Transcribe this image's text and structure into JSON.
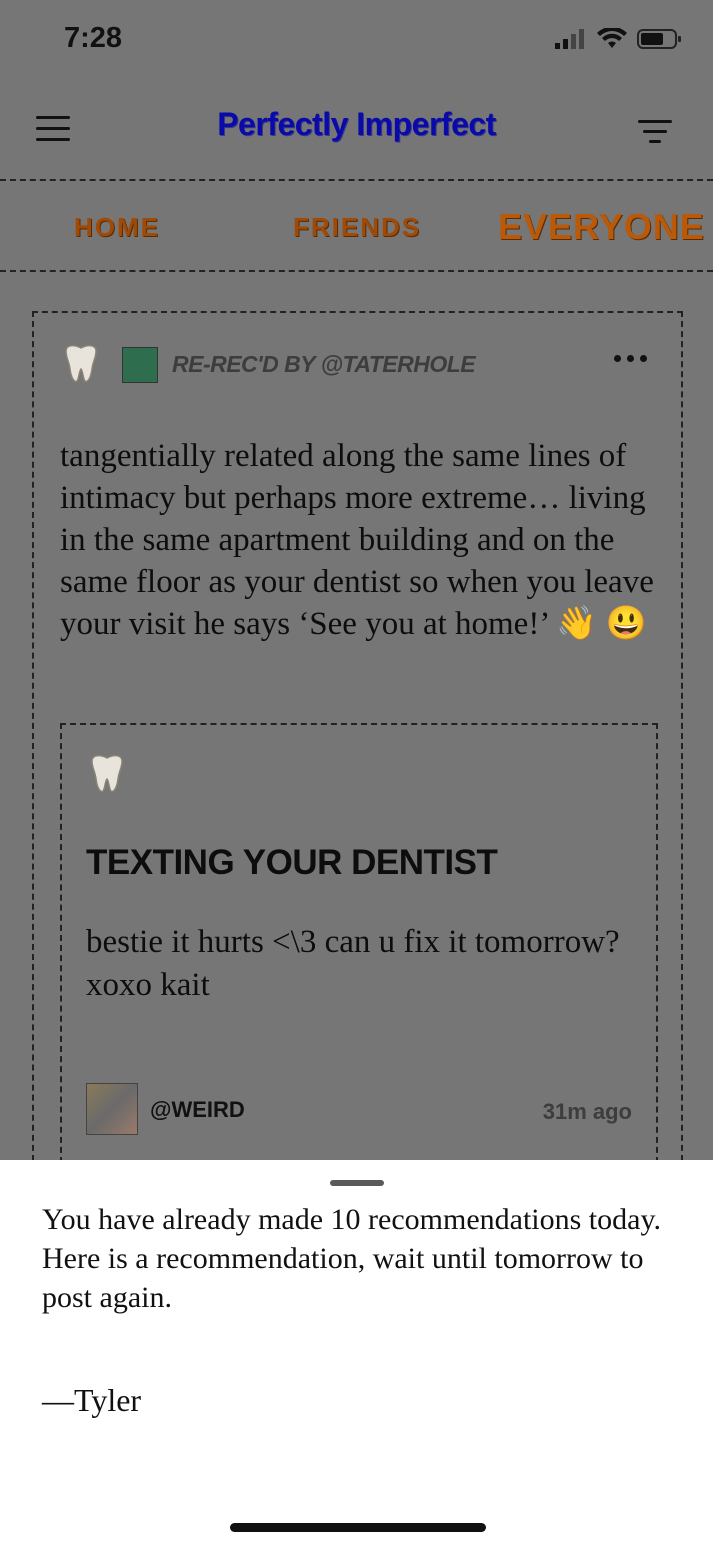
{
  "status_bar": {
    "time": "7:28"
  },
  "header": {
    "title": "Perfectly Imperfect"
  },
  "tabs": [
    {
      "label": "HOME"
    },
    {
      "label": "FRIENDS"
    },
    {
      "label": "EVERYONE",
      "active": true
    }
  ],
  "post": {
    "icon": "tooth-icon",
    "rerec_label": "RE-REC'D BY @TATERHOLE",
    "body": "tangentially related along the same lines of intimacy but perhaps more extreme… living in the same apartment building and on the same floor as your dentist so when you leave your visit he says ‘See you at home!’",
    "emojis": "👋 😃",
    "quoted": {
      "icon": "tooth-icon",
      "title": "TEXTING YOUR DENTIST",
      "body": "bestie it hurts <\\3 can u fix it tomorrow? xoxo kait",
      "author": "@WEIRD",
      "time": "31m ago"
    }
  },
  "sheet": {
    "message": "You have already made 10 recommendations today. Here is a recommendation, wait until tomorrow to post again.",
    "signature": "—Tyler"
  },
  "colors": {
    "title": "#0a0aa8",
    "tab": "#a04a08",
    "overlay": "#767676",
    "sheet": "#ffffff"
  }
}
